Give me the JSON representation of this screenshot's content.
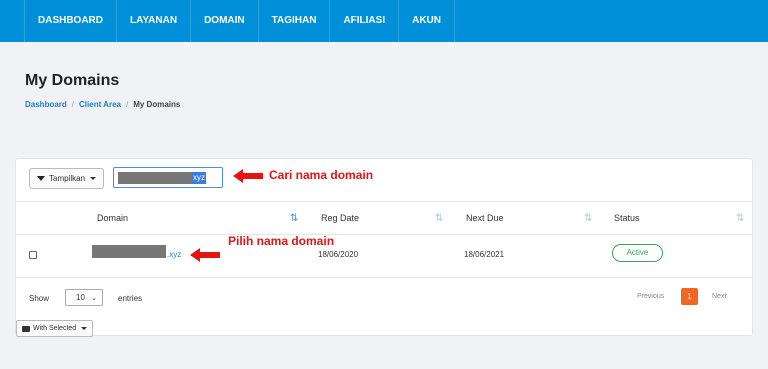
{
  "nav": {
    "items": [
      "DASHBOARD",
      "LAYANAN",
      "DOMAIN",
      "TAGIHAN",
      "AFILIASI",
      "AKUN"
    ]
  },
  "page": {
    "title": "My Domains",
    "breadcrumb": [
      "Dashboard",
      "Client Area",
      "My Domains"
    ]
  },
  "toolbar": {
    "filter_label": "Tampilkan",
    "search_value_tld": "xyz"
  },
  "annotations": {
    "search_hint": "Cari nama domain",
    "row_hint": "Pilih nama domain",
    "color": "#e21414"
  },
  "table": {
    "columns": [
      "Domain",
      "Reg Date",
      "Next Due",
      "Status"
    ],
    "rows": [
      {
        "domain_tld": ".xyz",
        "reg_date": "18/06/2020",
        "next_due": "18/06/2021",
        "status": "Active"
      }
    ]
  },
  "footer": {
    "show_label": "Show",
    "entries_value": "10",
    "entries_label": "entries",
    "prev": "Previous",
    "page": "1",
    "next": "Next",
    "with_selected": "With Selected"
  },
  "colors": {
    "nav_bg": "#0090d9",
    "accent": "#1f7fce",
    "status_active": "#3aa655",
    "page_active": "#f26522"
  }
}
